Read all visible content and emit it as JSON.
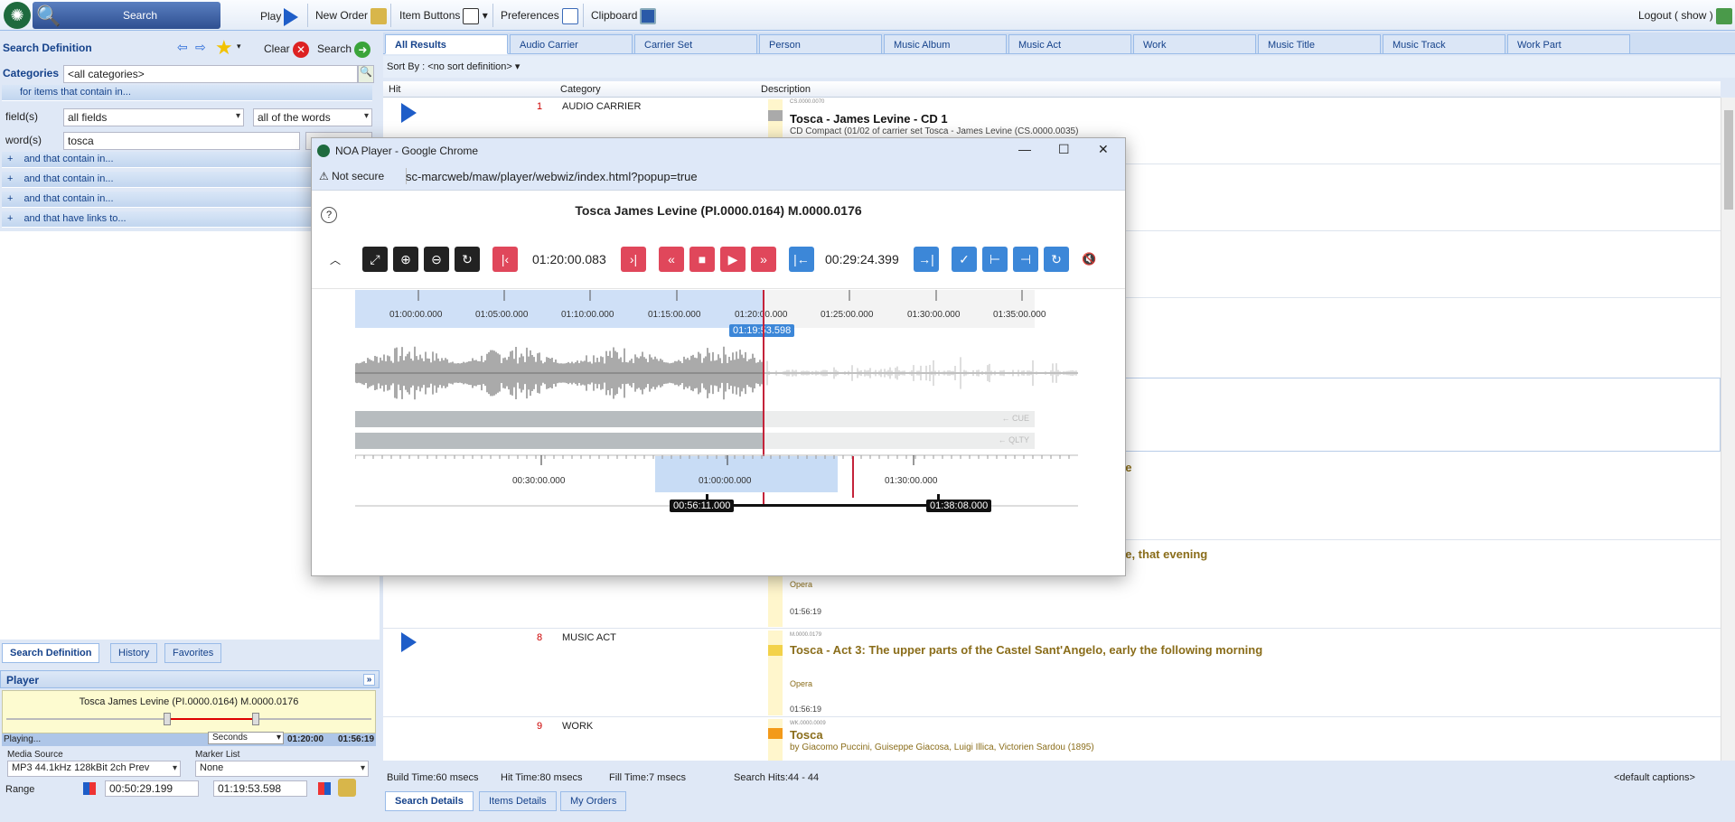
{
  "topbar": {
    "search": "Search",
    "play": "Play",
    "new_order": "New Order",
    "item_buttons": "Item Buttons",
    "preferences": "Preferences",
    "clipboard": "Clipboard",
    "logout": "Logout ( show )"
  },
  "search_def": {
    "title": "Search Definition",
    "clear": "Clear",
    "search": "Search",
    "categories_label": "Categories",
    "categories_value": "<all categories>",
    "contain_header": "for items that contain in...",
    "fields_label": "field(s)",
    "fields_value": "all fields",
    "mode_value": "all of the words",
    "words_label": "word(s)",
    "words_value": "tosca",
    "groups": [
      "and that contain in...",
      "and that contain in...",
      "and that contain in...",
      "and that have links to..."
    ]
  },
  "left_tabs": [
    "Search Definition",
    "History",
    "Favorites"
  ],
  "player": {
    "header": "Player",
    "track": "Tosca James Levine (PI.0000.0164) M.0000.0176",
    "status": "Playing...",
    "unit": "Seconds",
    "time1": "01:20:00",
    "time2": "01:56:19",
    "media_source_label": "Media Source",
    "media_source_value": "MP3 44.1kHz 128kBit 2ch Prev",
    "marker_list_label": "Marker List",
    "marker_list_value": "None",
    "range_label": "Range",
    "range_start": "00:50:29.199",
    "range_end": "01:19:53.598"
  },
  "result_tabs": [
    "All Results",
    "Audio Carrier",
    "Carrier Set",
    "Person",
    "Music Album",
    "Music Act",
    "Work",
    "Music Title",
    "Music Track",
    "Work Part"
  ],
  "sort": "Sort By : <no sort definition>",
  "columns": {
    "hit": "Hit",
    "category": "Category",
    "description": "Description"
  },
  "results": [
    {
      "num": "1",
      "cat": "AUDIO CARRIER",
      "code": "CS.0000.0070",
      "title": "Tosca - James Levine - CD 1",
      "sub": "CD Compact (01/02 of carrier set Tosca - James Levine (CS.0000.0035)"
    },
    {
      "title_frag": "lle"
    },
    {
      "title_frag": "se, that evening",
      "tag": "Opera",
      "dur": "01:56:19"
    },
    {
      "num": "8",
      "cat": "MUSIC ACT",
      "code": "M.0000.0179",
      "title": "Tosca - Act 3: The upper parts of the Castel Sant'Angelo, early the following morning",
      "tag": "Opera",
      "dur": "01:56:19"
    },
    {
      "num": "9",
      "cat": "WORK",
      "code": "WK.0000.0009",
      "title": "Tosca",
      "sub": "by Giacomo Puccini, Guiseppe Giacosa, Luigi Illica, Victorien Sardou (1895)"
    }
  ],
  "status": {
    "build": "Build Time:60 msecs",
    "hit": "Hit Time:80 msecs",
    "fill": "Fill Time:7 msecs",
    "hits": "Search Hits:44 - 44",
    "captions": "<default captions>"
  },
  "bottom_tabs": [
    "Search Details",
    "Items Details",
    "My Orders"
  ],
  "popup": {
    "title": "NOA Player - Google Chrome",
    "not_secure": "Not secure",
    "url": "sc-marcweb/maw/player/webwiz/index.html?popup=true",
    "track": "Tosca James Levine (PI.0000.0164) M.0000.0176",
    "time_a": "01:20:00.083",
    "time_b": "00:29:24.399",
    "ticks": [
      "01:00:00.000",
      "01:05:00.000",
      "01:10:00.000",
      "01:15:00.000",
      "01:20:00.000",
      "01:25:00.000",
      "01:30:00.000",
      "01:35:00.000"
    ],
    "cursor": "01:19:53.598",
    "cue": "← CUE",
    "qlty": "← QLTY",
    "overview_ticks": [
      "00:30:00.000",
      "01:00:00.000",
      "01:30:00.000"
    ],
    "range_start": "00:56:11.000",
    "range_end": "01:38:08.000"
  }
}
